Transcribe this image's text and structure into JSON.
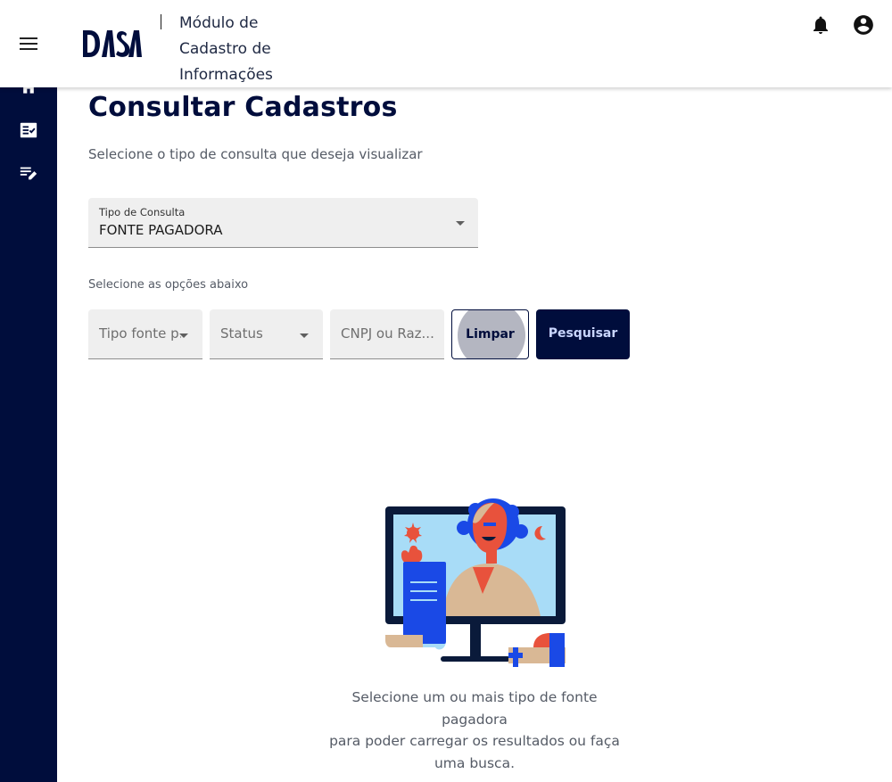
{
  "header": {
    "brand": "DASA",
    "module_line1": "Módulo de",
    "module_line2": "Cadastro de",
    "module_line3": "Informações"
  },
  "sidebar": {
    "items": [
      {
        "icon": "home-icon"
      },
      {
        "icon": "checklist-icon"
      },
      {
        "icon": "edit-list-icon"
      }
    ]
  },
  "page": {
    "title": "Consultar Cadastros",
    "subtitle": "Selecione o tipo de consulta que deseja visualizar"
  },
  "query_type": {
    "label": "Tipo de Consulta",
    "value": "FONTE PAGADORA"
  },
  "options": {
    "label": "Selecione as opções abaixo",
    "tipo_fonte_placeholder": "Tipo fonte p...",
    "status_placeholder": "Status",
    "cnpj_placeholder": "CNPJ ou Raz..."
  },
  "buttons": {
    "clear": "Limpar",
    "search": "Pesquisar"
  },
  "empty_state": {
    "line1": "Selecione um ou mais tipo de fonte pagadora",
    "line2": "para poder carregar os resultados ou faça",
    "line3": "uma busca."
  },
  "colors": {
    "navy": "#000d3c",
    "accent_blue": "#1a49e6",
    "accent_red": "#e8523c",
    "field_bg": "#efefef"
  }
}
